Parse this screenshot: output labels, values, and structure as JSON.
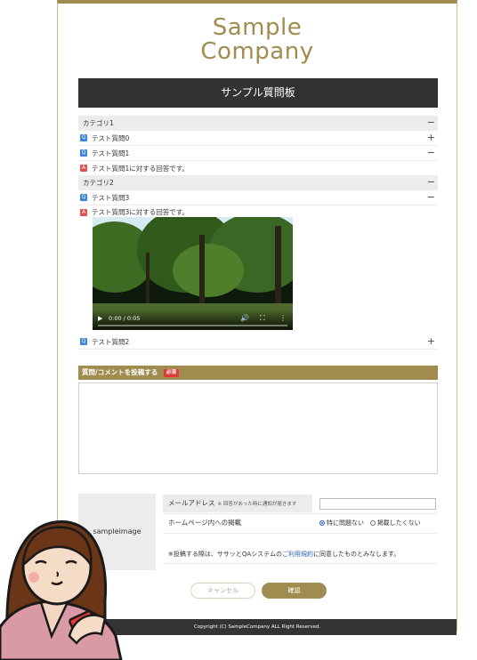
{
  "logo": {
    "line1": "Sample",
    "line2": "Company"
  },
  "board_title": "サンプル質問板",
  "categories": [
    {
      "label": "カテゴリ1",
      "toggle": "−"
    },
    {
      "label": "カテゴリ2",
      "toggle": "−"
    }
  ],
  "questions": [
    {
      "badge": "Q",
      "text": "テスト質問0",
      "toggle": "+"
    },
    {
      "badge": "Q",
      "text": "テスト質問1",
      "toggle": "−"
    },
    {
      "badge": "A",
      "text": "テスト質問1に対する回答です。"
    },
    {
      "badge": "Q",
      "text": "テスト質問3",
      "toggle": "−"
    },
    {
      "badge": "A",
      "text": "テスト質問3に対する回答です。"
    },
    {
      "badge": "Q",
      "text": "テスト質問2",
      "toggle": "+"
    }
  ],
  "video": {
    "time": "0:00 / 0:05"
  },
  "post_form": {
    "header": "質問/コメントを投稿する",
    "required": "必須",
    "sample_image_label": "sampleimage",
    "email_label": "メールアドレス",
    "email_note": "※ 回答があった時に通知が届きます",
    "publish_label": "ホームページ内への掲載",
    "publish_options": [
      "特に問題ない",
      "掲載したくない"
    ],
    "terms_prefix": "※投稿する際は、ササッとQAシステムの",
    "terms_link": "ご利用規約",
    "terms_suffix": "に同意したものとみなします。",
    "cancel_label": "キャンセル",
    "confirm_label": "確認"
  },
  "footer": "Copyright (C) SampleCompany ALL Right Reserved.",
  "colors": {
    "accent": "#a08c4f",
    "dark": "#323232",
    "q_badge": "#3d84d6",
    "a_badge": "#e05252"
  }
}
